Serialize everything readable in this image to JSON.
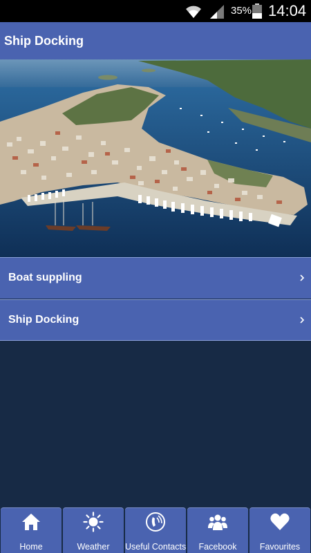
{
  "status_bar": {
    "battery_percent": "35%",
    "time": "14:04"
  },
  "header": {
    "title": "Ship Docking"
  },
  "hero": {
    "icon": "aerial-harbor-photo"
  },
  "menu": {
    "items": [
      {
        "label": "Boat suppling"
      },
      {
        "label": "Ship Docking"
      }
    ]
  },
  "bottom_nav": {
    "items": [
      {
        "label": "Home",
        "icon": "home-icon"
      },
      {
        "label": "Weather",
        "icon": "sun-icon"
      },
      {
        "label": "Useful Contacts",
        "icon": "phone-icon"
      },
      {
        "label": "Facebook",
        "icon": "people-icon"
      },
      {
        "label": "Favourites",
        "icon": "heart-icon"
      }
    ]
  },
  "colors": {
    "primary": "#4a63b0",
    "background": "#172a45",
    "status_bar": "#000000"
  }
}
